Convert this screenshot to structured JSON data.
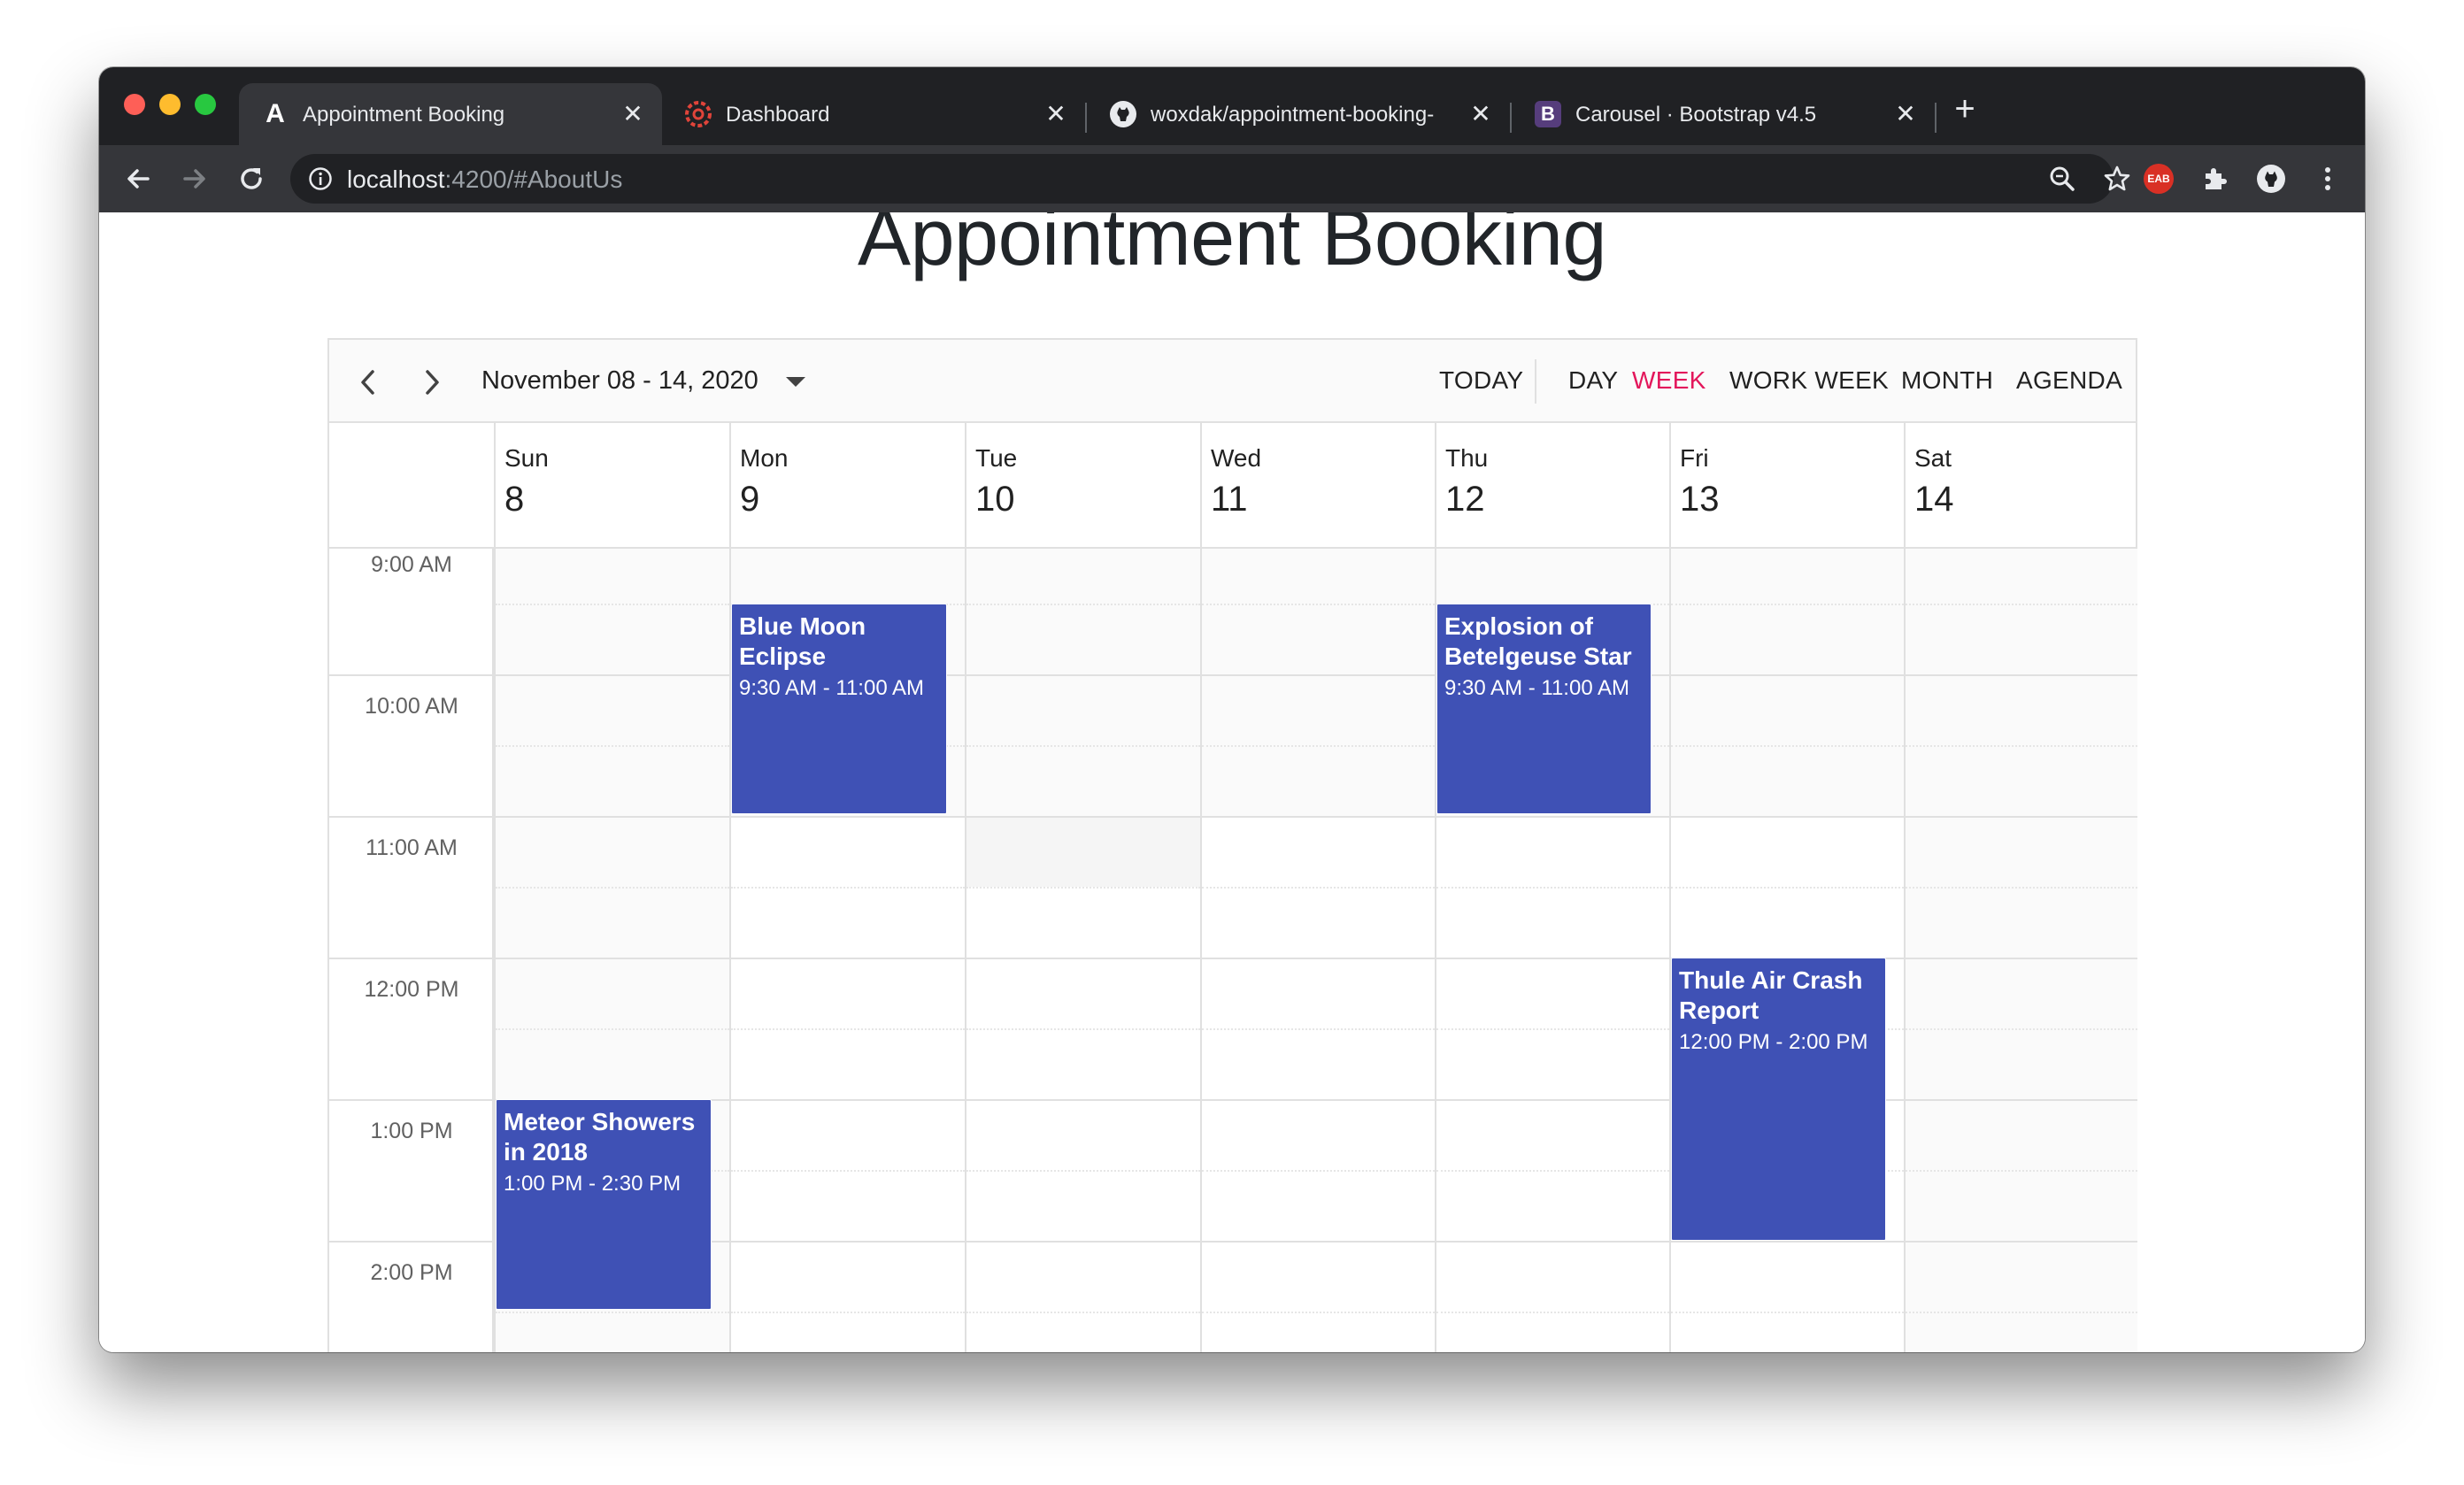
{
  "browser": {
    "tabs": [
      {
        "title": "Appointment Booking",
        "favicon": "angular-icon",
        "active": true
      },
      {
        "title": "Dashboard",
        "favicon": "dashboard-icon",
        "active": false
      },
      {
        "title": "woxdak/appointment-booking-",
        "favicon": "github-icon",
        "active": false
      },
      {
        "title": "Carousel · Bootstrap v4.5",
        "favicon": "bootstrap-icon",
        "active": false
      }
    ],
    "favicon_letters": {
      "angular": "A",
      "bootstrap": "B"
    },
    "close_glyph": "✕",
    "new_tab_glyph": "+",
    "url_host": "localhost",
    "url_rest": ":4200/#AboutUs",
    "extension_badge": "EAB",
    "colors": {
      "titlebar": "#202124",
      "toolbar": "#35363a",
      "omnibox": "#202124"
    }
  },
  "page": {
    "title": "Appointment Booking"
  },
  "scheduler": {
    "date_range": "November 08 - 14, 2020",
    "views": {
      "today": "TODAY",
      "day": "DAY",
      "week": "WEEK",
      "work_week": "WORK WEEK",
      "month": "MONTH",
      "agenda": "AGENDA"
    },
    "selected_view": "WEEK",
    "days": [
      {
        "name": "Sun",
        "date": "8"
      },
      {
        "name": "Mon",
        "date": "9"
      },
      {
        "name": "Tue",
        "date": "10"
      },
      {
        "name": "Wed",
        "date": "11"
      },
      {
        "name": "Thu",
        "date": "12"
      },
      {
        "name": "Fri",
        "date": "13"
      },
      {
        "name": "Sat",
        "date": "14"
      }
    ],
    "times": [
      "9:00 AM",
      "10:00 AM",
      "11:00 AM",
      "12:00 PM",
      "1:00 PM",
      "2:00 PM"
    ],
    "events": [
      {
        "title": "Blue Moon Eclipse",
        "time": "9:30 AM - 11:00 AM"
      },
      {
        "title": "Explosion of Betelgeuse Star",
        "time": "9:30 AM - 11:00 AM"
      },
      {
        "title": "Thule Air Crash Report",
        "time": "12:00 PM - 2:00 PM"
      },
      {
        "title": "Meteor Showers in 2018",
        "time": "1:00 PM - 2:30 PM"
      }
    ],
    "colors": {
      "event": "#3f51b5",
      "accent": "#e3165b",
      "border": "#e0e0e0"
    }
  }
}
